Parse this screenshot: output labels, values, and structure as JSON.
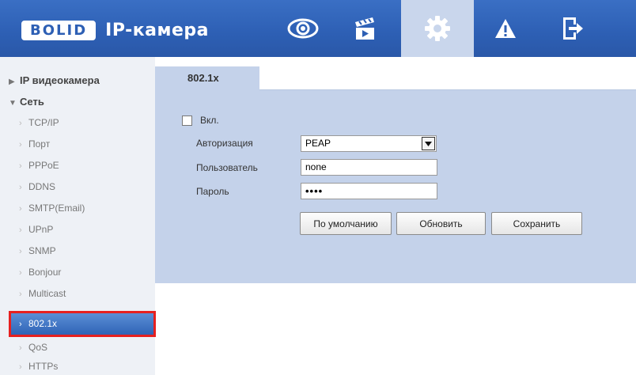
{
  "header": {
    "logo_text": "BOLID",
    "title": "IP-камера",
    "nav": [
      {
        "name": "live-view",
        "icon": "eye-icon"
      },
      {
        "name": "playback",
        "icon": "clapperboard-icon"
      },
      {
        "name": "settings",
        "icon": "gear-icon",
        "active": true
      },
      {
        "name": "alarm",
        "icon": "warning-icon"
      },
      {
        "name": "logout",
        "icon": "exit-icon"
      }
    ]
  },
  "sidebar": {
    "sections": [
      {
        "label": "IP видеокамера",
        "expanded": false
      },
      {
        "label": "Сеть",
        "expanded": true
      }
    ],
    "items": [
      {
        "label": "TCP/IP"
      },
      {
        "label": "Порт"
      },
      {
        "label": "PPPoE"
      },
      {
        "label": "DDNS"
      },
      {
        "label": "SMTP(Email)"
      },
      {
        "label": "UPnP"
      },
      {
        "label": "SNMP"
      },
      {
        "label": "Bonjour"
      },
      {
        "label": "Multicast"
      },
      {
        "label": "802.1x",
        "active": true
      },
      {
        "label": "QoS"
      },
      {
        "label": "HTTPs"
      }
    ]
  },
  "main": {
    "tab_label": "802.1x",
    "enable_label": "Вкл.",
    "enable_checked": false,
    "auth_label": "Авторизация",
    "auth_value": "PEAP",
    "user_label": "Пользователь",
    "user_value": "none",
    "password_label": "Пароль",
    "password_value": "••••",
    "buttons": {
      "default": "По умолчанию",
      "refresh": "Обновить",
      "save": "Сохранить"
    }
  },
  "colors": {
    "header_blue": "#2d5fb4",
    "panel_blue": "#c4d2ea",
    "sidebar_bg": "#eef1f6",
    "active_item": "#3a6fc4",
    "highlight_red": "#e62020"
  }
}
